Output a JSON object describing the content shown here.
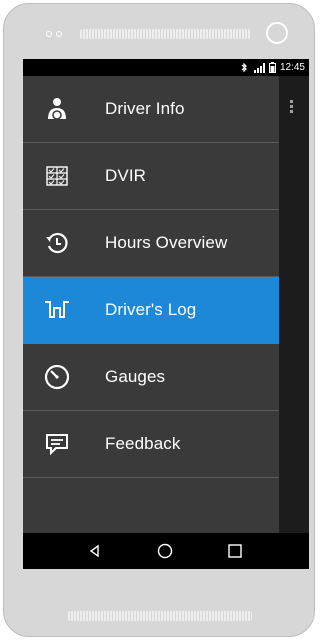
{
  "status_bar": {
    "time": "12:45",
    "icons": [
      "bluetooth-icon",
      "signal-icon",
      "battery-icon"
    ]
  },
  "drawer": {
    "items": [
      {
        "label": "Driver Info",
        "icon": "driver-icon",
        "active": false
      },
      {
        "label": "DVIR",
        "icon": "checklist-icon",
        "active": false
      },
      {
        "label": "Hours Overview",
        "icon": "history-clock-icon",
        "active": false
      },
      {
        "label": "Driver's Log",
        "icon": "log-graph-icon",
        "active": true
      },
      {
        "label": "Gauges",
        "icon": "gauge-icon",
        "active": false
      },
      {
        "label": "Feedback",
        "icon": "feedback-icon",
        "active": false
      }
    ]
  },
  "colors": {
    "drawer_bg": "#3a3a3a",
    "active_bg": "#1e88d8",
    "divider": "#5a5a5a",
    "device_body": "#d7d7d7"
  },
  "nav_bar": {
    "buttons": [
      "back-icon",
      "home-icon",
      "recents-icon"
    ]
  }
}
